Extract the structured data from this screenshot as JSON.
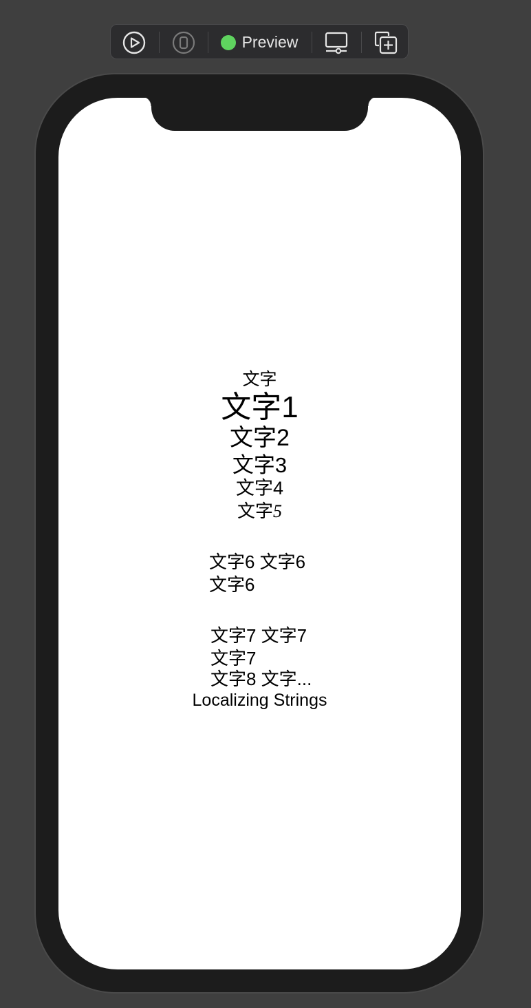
{
  "toolbar": {
    "items": [
      {
        "icon": "play-circle-icon"
      },
      {
        "icon": "device-icon"
      },
      {
        "icon": "green-status-dot",
        "label": "Preview",
        "color": "#5fd35f"
      },
      {
        "icon": "device-settings-icon"
      },
      {
        "icon": "duplicate-preview-icon"
      }
    ]
  },
  "screen": {
    "text_small": "文字",
    "text1": "文字1",
    "text2": "文字2",
    "text3": "文字3",
    "text4": "文字4",
    "text5_prefix": "文字",
    "text5_num": "5",
    "text6_line1": "文字6 文字6",
    "text6_line2": "文字6",
    "text7_line1": "文字7 文字7",
    "text7_line2": "文字7",
    "text8": "文字8 文字...",
    "localizing": "Localizing Strings"
  }
}
